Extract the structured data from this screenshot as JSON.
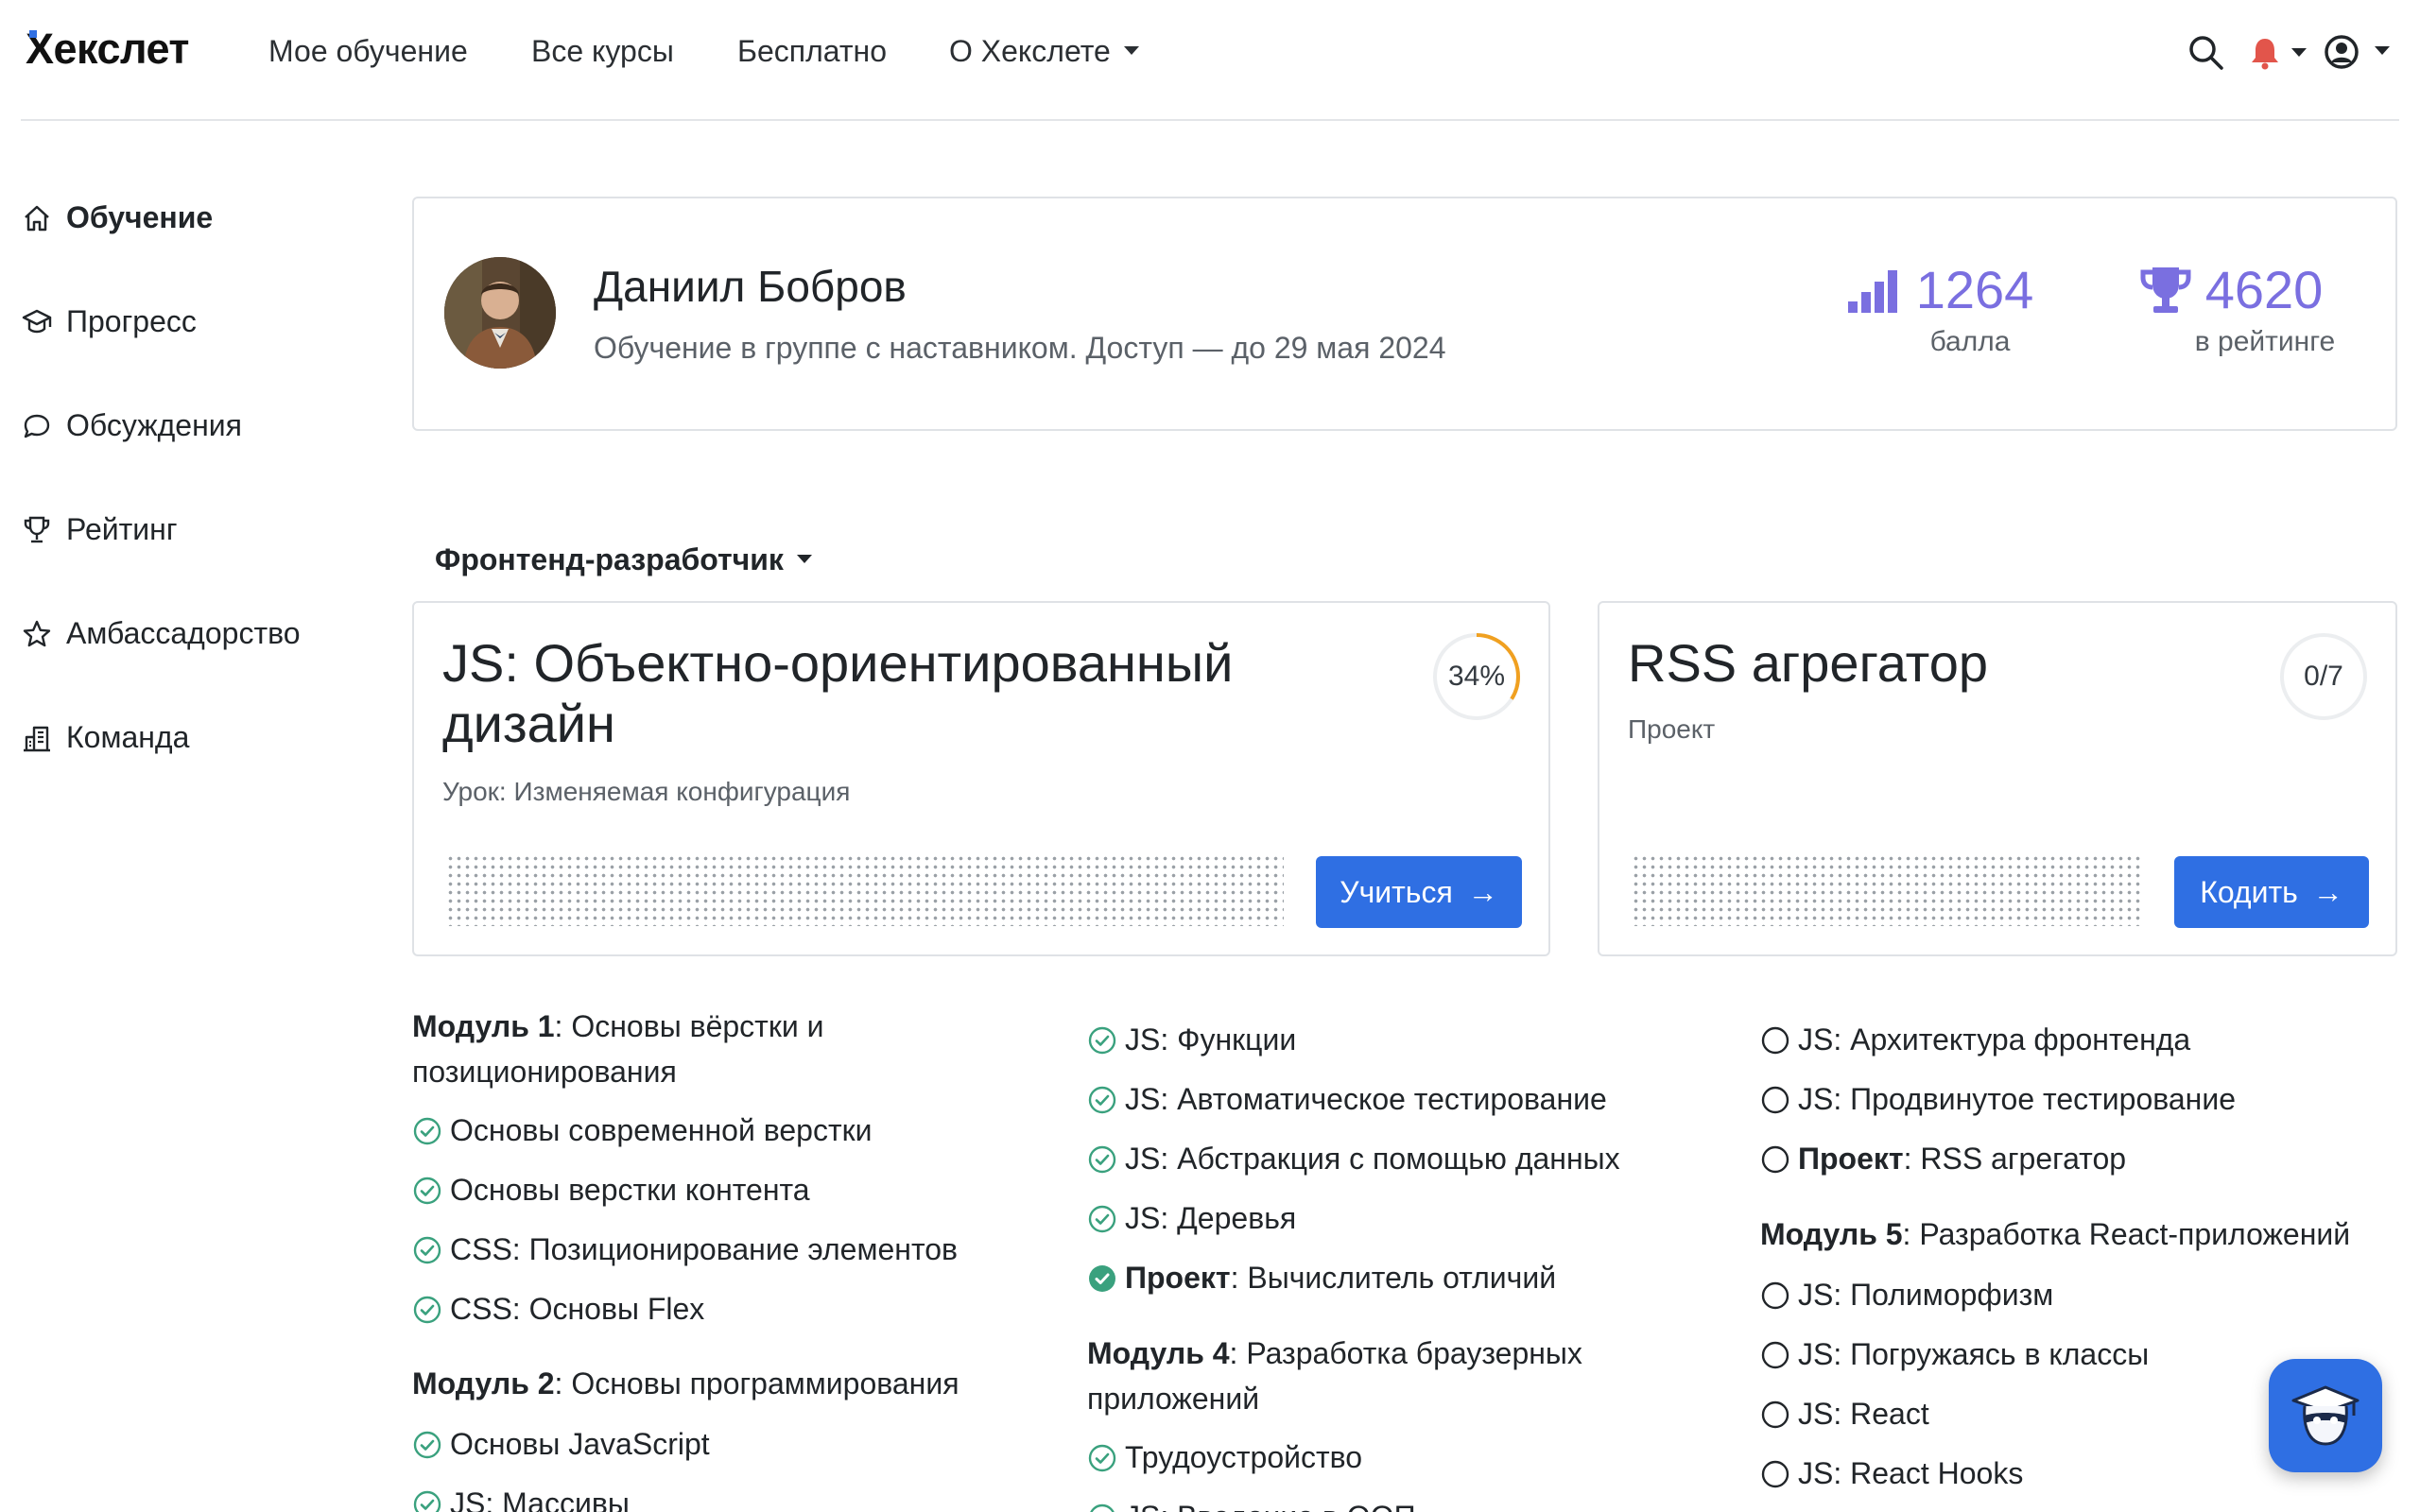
{
  "header": {
    "logo": "Хекслет",
    "nav": [
      {
        "label": "Мое обучение"
      },
      {
        "label": "Все курсы"
      },
      {
        "label": "Бесплатно"
      },
      {
        "label": "О Хекслете"
      }
    ]
  },
  "sidebar": {
    "items": [
      {
        "label": "Обучение",
        "icon": "home-icon",
        "active": true
      },
      {
        "label": "Прогресс",
        "icon": "graduation-cap-icon"
      },
      {
        "label": "Обсуждения",
        "icon": "chat-bubble-icon"
      },
      {
        "label": "Рейтинг",
        "icon": "trophy-icon"
      },
      {
        "label": "Амбассадорство",
        "icon": "star-icon"
      },
      {
        "label": "Команда",
        "icon": "buildings-icon"
      }
    ]
  },
  "profile": {
    "name": "Даниил Бобров",
    "subtitle": "Обучение в группе с наставником. Доступ — до 29 мая 2024",
    "points_value": "1264",
    "points_label": "балла",
    "rating_value": "4620",
    "rating_label": "в рейтинге"
  },
  "track": {
    "label": "Фронтенд-разработчик"
  },
  "course_card": {
    "title_line1": "JS: Объектно-ориентированный",
    "title_line2": "дизайн",
    "lesson": "Урок: Изменяемая конфигурация",
    "progress_text": "34%",
    "progress_value": 0.34,
    "button": "Учиться"
  },
  "project_card": {
    "title": "RSS агрегатор",
    "type": "Проект",
    "progress_text": "0/7",
    "button": "Кодить"
  },
  "modules": {
    "col1": {
      "m1_bold": "Модуль 1",
      "m1_title_a": ": Основы вёрстки и",
      "m1_title_b": "позиционирования",
      "m1_items": [
        "Основы современной верстки",
        "Основы верстки контента",
        "CSS: Позиционирование элементов",
        "CSS: Основы Flex"
      ],
      "m2_bold": "Модуль 2",
      "m2_title": ": Основы программирования",
      "m2_items": [
        "Основы JavaScript",
        "JS: Массивы"
      ]
    },
    "col2": {
      "items_top": [
        "JS: Функции",
        "JS: Автоматическое тестирование",
        "JS: Абстракция с помощью данных",
        "JS: Деревья"
      ],
      "project_bold": "Проект",
      "project_rest": ": Вычислитель отличий",
      "m4_bold": "Модуль 4",
      "m4_title_a": ": Разработка браузерных",
      "m4_title_b": "приложений",
      "m4_items": [
        "Трудоустройство",
        "JS: Введение в ООП"
      ]
    },
    "col3": {
      "items_top": [
        "JS: Архитектура фронтенда",
        "JS: Продвинутое тестирование"
      ],
      "project_bold": "Проект",
      "project_rest": ": RSS агрегатор",
      "m5_bold": "Модуль 5",
      "m5_title": ": Разработка React-приложений",
      "m5_items": [
        "JS: Полиморфизм",
        "JS: Погружаясь в классы",
        "JS: React",
        "JS: React Hooks"
      ]
    }
  },
  "colors": {
    "accent": "#2f6fe3",
    "stat": "#7a6fe0",
    "done": "#3aa17e",
    "bell": "#e2554b",
    "progress": "#f0a020"
  }
}
